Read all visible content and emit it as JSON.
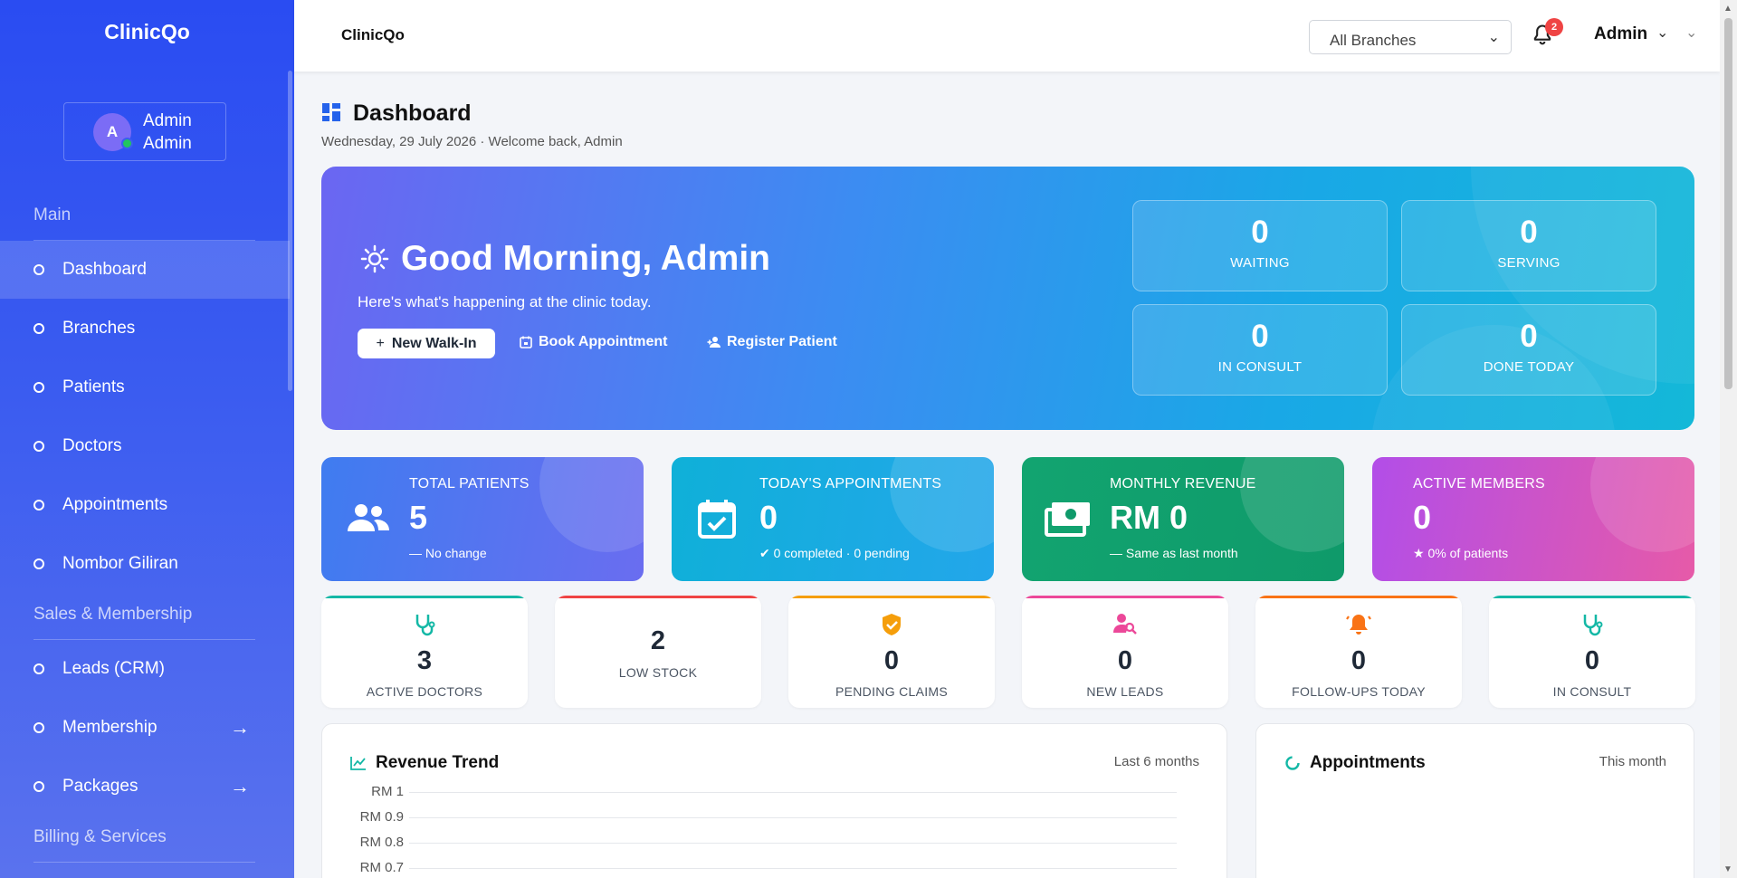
{
  "sidebar": {
    "brand": "ClinicQo",
    "user": {
      "initial": "A",
      "name_line1": "Admin",
      "name_line2": "Admin"
    },
    "sections": {
      "main": "Main",
      "sales": "Sales & Membership",
      "billing": "Billing & Services"
    },
    "items": [
      {
        "label": "Dashboard",
        "active": true
      },
      {
        "label": "Branches"
      },
      {
        "label": "Patients"
      },
      {
        "label": "Doctors"
      },
      {
        "label": "Appointments"
      },
      {
        "label": "Nombor Giliran"
      },
      {
        "label": "Leads (CRM)"
      },
      {
        "label": "Membership",
        "arrow": "→"
      },
      {
        "label": "Packages",
        "arrow": "→"
      }
    ]
  },
  "topbar": {
    "title": "ClinicQo",
    "branch_select": "All Branches",
    "notification_count": "2",
    "admin_label": "Admin"
  },
  "page": {
    "title": "Dashboard",
    "subtitle": "Wednesday, 29 July 2026 · Welcome back, Admin"
  },
  "hero": {
    "greeting": "Good Morning, Admin",
    "subtitle": "Here's what's happening at the clinic today.",
    "buttons": {
      "walk_in": "New Walk-In",
      "book": "Book Appointment",
      "register": "Register Patient"
    },
    "stats": [
      {
        "value": "0",
        "label": "WAITING"
      },
      {
        "value": "0",
        "label": "SERVING"
      },
      {
        "value": "0",
        "label": "IN CONSULT"
      },
      {
        "value": "0",
        "label": "DONE TODAY"
      }
    ]
  },
  "kpis": [
    {
      "title": "TOTAL PATIENTS",
      "value": "5",
      "note": "No change",
      "note_icon": "minus-icon",
      "color": "#4a74f0"
    },
    {
      "title": "TODAY'S APPOINTMENTS",
      "value": "0",
      "note": "0 completed · 0 pending",
      "note_icon": "check-circle-icon",
      "color": "#13aee0"
    },
    {
      "title": "MONTHLY REVENUE",
      "value": "RM 0",
      "note": "Same as last month",
      "note_icon": "minus-icon",
      "color": "#14a06b"
    },
    {
      "title": "ACTIVE MEMBERS",
      "value": "0",
      "note": "0% of patients",
      "note_icon": "star-icon",
      "color": "#c34fe0"
    }
  ],
  "mini_stats": [
    {
      "value": "3",
      "label": "ACTIVE DOCTORS",
      "icon": "stethoscope-icon",
      "color": "#14b8a6"
    },
    {
      "value": "2",
      "label": "LOW STOCK",
      "icon": "",
      "color": "#ef4444"
    },
    {
      "value": "0",
      "label": "PENDING CLAIMS",
      "icon": "shield-check-icon",
      "color": "#f59e0b"
    },
    {
      "value": "0",
      "label": "NEW LEADS",
      "icon": "user-search-icon",
      "color": "#ec4899"
    },
    {
      "value": "0",
      "label": "FOLLOW-UPS TODAY",
      "icon": "bell-ring-icon",
      "color": "#f97316"
    },
    {
      "value": "0",
      "label": "IN CONSULT",
      "icon": "stethoscope-icon",
      "color": "#14b8a6"
    }
  ],
  "revenue_panel": {
    "title": "Revenue Trend",
    "meta": "Last 6 months",
    "y_ticks": [
      "RM 1",
      "RM 0.9",
      "RM 0.8",
      "RM 0.7"
    ]
  },
  "appointments_panel": {
    "title": "Appointments",
    "meta": "This month"
  },
  "colors": {
    "sidebar": "#2a4cf2",
    "accent": "#3b82f6",
    "badge": "#ef4444"
  }
}
